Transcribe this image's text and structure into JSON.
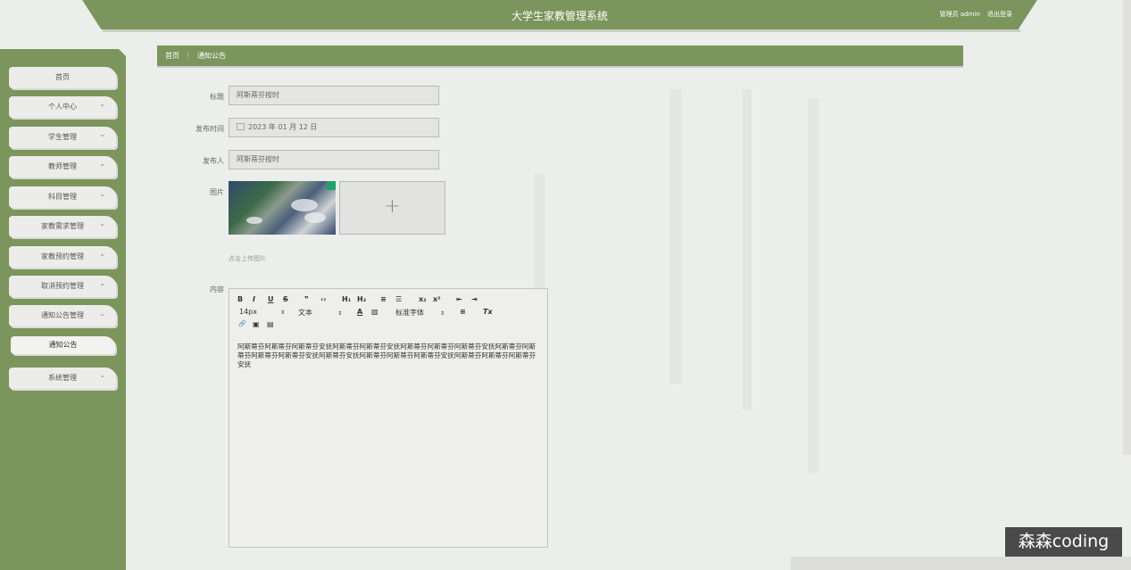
{
  "header": {
    "title": "大学生家教管理系统",
    "role": "管理员 admin",
    "logout": "退出登录"
  },
  "sidebar": {
    "items": [
      {
        "label": "首页",
        "expandable": false
      },
      {
        "label": "个人中心",
        "expandable": true
      },
      {
        "label": "学生管理",
        "expandable": true
      },
      {
        "label": "教师管理",
        "expandable": true
      },
      {
        "label": "科目管理",
        "expandable": true
      },
      {
        "label": "家教需求管理",
        "expandable": true
      },
      {
        "label": "家教预约管理",
        "expandable": true
      },
      {
        "label": "取消预约管理",
        "expandable": true
      },
      {
        "label": "通知公告管理",
        "expandable": true,
        "expanded": true
      },
      {
        "label": "系统管理",
        "expandable": true
      }
    ],
    "subitem": "通知公告"
  },
  "breadcrumb": {
    "home": "首页",
    "separator": "⋮",
    "current": "通知公告"
  },
  "form": {
    "title_label": "标题",
    "title_value": "阿斯蒂芬按时",
    "date_label": "发布时间",
    "date_value": "2023 年 01 月 12 日",
    "publisher_label": "发布人",
    "publisher_value": "阿斯蒂芬按时",
    "image_label": "图片",
    "upload_plus": "+",
    "upload_hint": "点击上传图片",
    "content_label": "内容"
  },
  "editor": {
    "toolbar_row1": [
      "B",
      "I",
      "U",
      "S",
      "❞",
      "‹›",
      "H₁",
      "H₂",
      "≡",
      "☰",
      "x₂",
      "x²",
      "⇤",
      "⇥"
    ],
    "font_size": "14px",
    "text_style": "文本",
    "font_family": "标准字体",
    "row2_icons": [
      "A",
      "▨",
      "≡",
      "Tx"
    ],
    "row3_icons": [
      "🔗",
      "▣",
      "▤"
    ],
    "content": "阿斯蒂芬阿斯蒂芬阿斯蒂芬安抚阿斯蒂芬阿斯蒂芬安抚阿斯蒂芬阿斯蒂芬阿斯蒂芬安抚阿斯蒂芬阿斯蒂芬阿斯蒂芬阿斯蒂芬安抚阿斯蒂芬安抚阿斯蒂芬阿斯蒂芬阿斯蒂芬安抚阿斯蒂芬阿斯蒂芬阿斯蒂芬安抚"
  },
  "watermark": "森森coding",
  "colors": {
    "primary": "#7b955c",
    "background": "#eceeec"
  }
}
